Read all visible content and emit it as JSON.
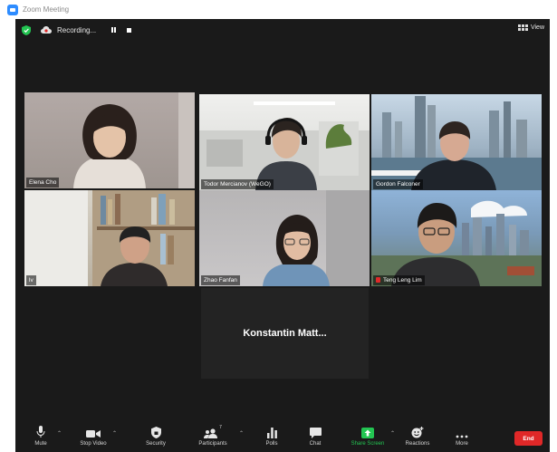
{
  "window": {
    "title": "Zoom Meeting"
  },
  "topbar": {
    "recording_label": "Recording...",
    "view_label": "View"
  },
  "tiles": [
    {
      "name": "Elena Cho",
      "active": true,
      "muted": false
    },
    {
      "name": "Todor Mercianov (WeGO)",
      "active": false,
      "muted": false
    },
    {
      "name": "Gordon Falconer",
      "active": false,
      "muted": false
    },
    {
      "name": "lv",
      "active": false,
      "muted": false
    },
    {
      "name": "Zhao Fanfan",
      "active": false,
      "muted": false
    },
    {
      "name": "Teng Leng Lim",
      "active": false,
      "muted": true
    }
  ],
  "no_video_participant": {
    "name": "Konstantin Matt..."
  },
  "toolbar": {
    "mute": "Mute",
    "stop_video": "Stop Video",
    "security": "Security",
    "participants": "Participants",
    "participants_count": "7",
    "polls": "Polls",
    "chat": "Chat",
    "share_screen": "Share Screen",
    "reactions": "Reactions",
    "more": "More",
    "end": "End"
  },
  "colors": {
    "meeting_bg": "#1a1a1a",
    "active_speaker": "#d8e03c",
    "share_green": "#23c552",
    "end_red": "#e02828",
    "zoom_blue": "#2d8cff"
  }
}
